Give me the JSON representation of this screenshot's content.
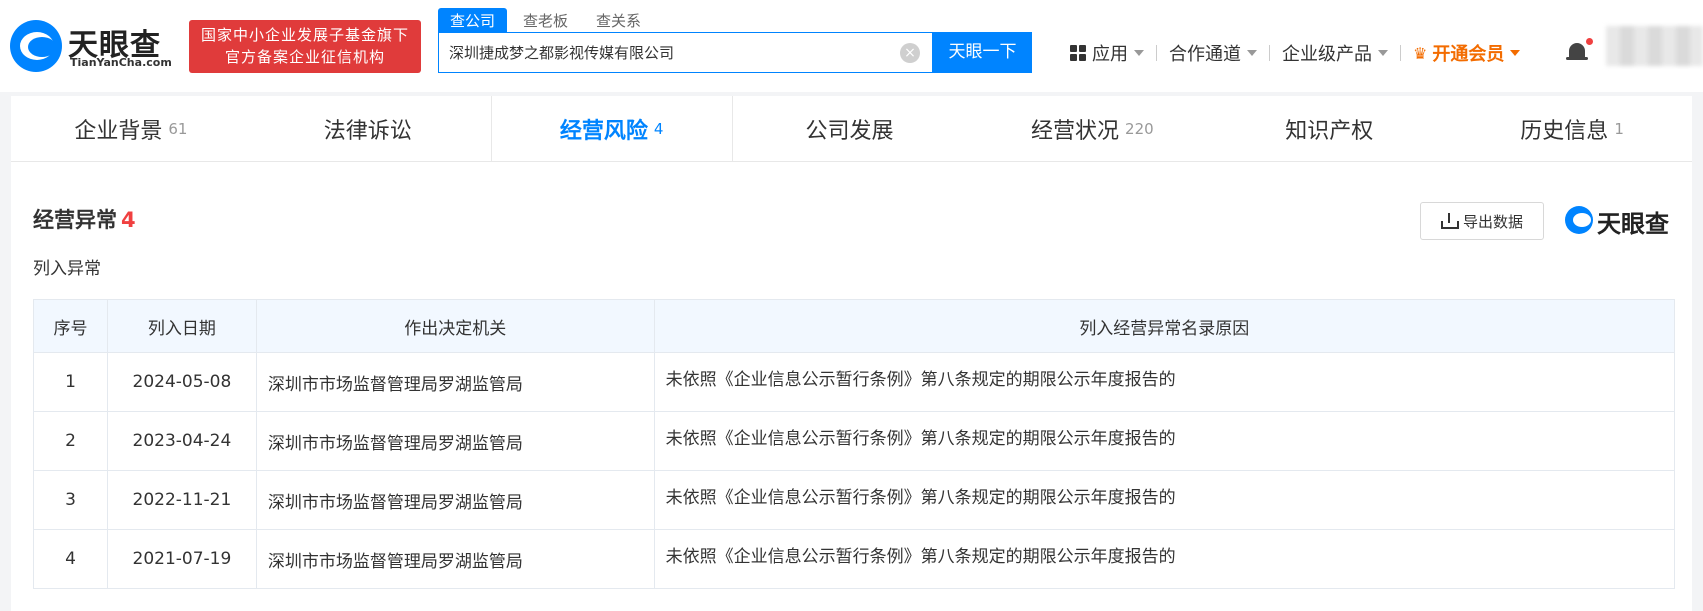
{
  "header": {
    "logo_cn": "天眼查",
    "logo_en": "TianYanCha.com",
    "slogan_line1": "国家中小企业发展子基金旗下",
    "slogan_line2": "官方备案企业征信机构",
    "search_tabs": [
      "查公司",
      "查老板",
      "查关系"
    ],
    "search_value": "深圳捷成梦之都影视传媒有限公司",
    "search_button": "天眼一下",
    "nav": {
      "apps": "应用",
      "partner": "合作通道",
      "enterprise": "企业级产品",
      "vip": "开通会员"
    }
  },
  "tabs": [
    {
      "label": "企业背景",
      "count": "61"
    },
    {
      "label": "法律诉讼",
      "count": ""
    },
    {
      "label": "经营风险",
      "count": "4"
    },
    {
      "label": "公司发展",
      "count": ""
    },
    {
      "label": "经营状况",
      "count": "220"
    },
    {
      "label": "知识产权",
      "count": ""
    },
    {
      "label": "历史信息",
      "count": "1"
    }
  ],
  "section": {
    "title": "经营异常",
    "count": "4",
    "subtitle": "列入异常",
    "export_label": "导出数据",
    "brand": "天眼查"
  },
  "table": {
    "headers": [
      "序号",
      "列入日期",
      "作出决定机关",
      "列入经营异常名录原因"
    ],
    "rows": [
      {
        "no": "1",
        "date": "2024-05-08",
        "authority": "深圳市市场监督管理局罗湖监管局",
        "reason": "未依照《企业信息公示暂行条例》第八条规定的期限公示年度报告的"
      },
      {
        "no": "2",
        "date": "2023-04-24",
        "authority": "深圳市市场监督管理局罗湖监管局",
        "reason": "未依照《企业信息公示暂行条例》第八条规定的期限公示年度报告的"
      },
      {
        "no": "3",
        "date": "2022-11-21",
        "authority": "深圳市市场监督管理局罗湖监管局",
        "reason": "未依照《企业信息公示暂行条例》第八条规定的期限公示年度报告的"
      },
      {
        "no": "4",
        "date": "2021-07-19",
        "authority": "深圳市市场监督管理局罗湖监管局",
        "reason": "未依照《企业信息公示暂行条例》第八条规定的期限公示年度报告的"
      }
    ]
  },
  "colors": {
    "accent": "#0084ff",
    "slogan_bg": "#e03b3b",
    "vip": "#f36c00",
    "count_red": "#f04040"
  }
}
